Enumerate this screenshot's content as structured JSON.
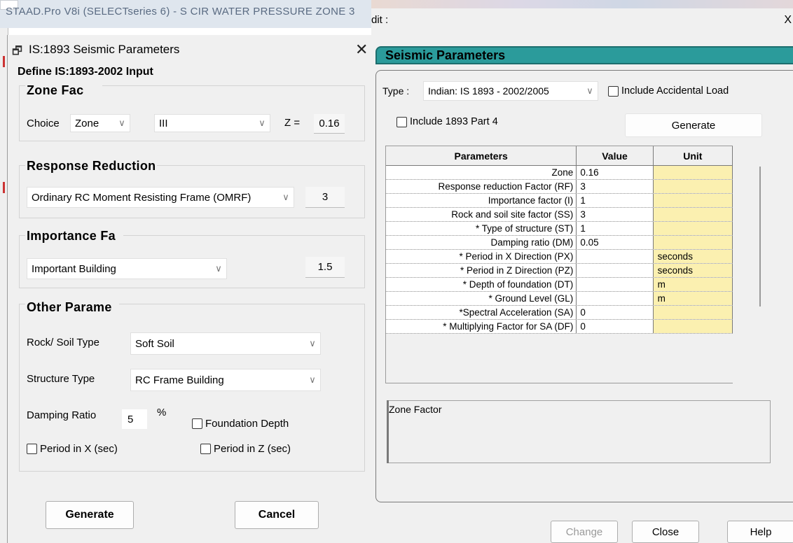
{
  "background_window": {
    "title_text": "STAAD.Pro V8i (SELECTseries 6) - S CIR WATER PRESSURE ZONE 3"
  },
  "left_dialog": {
    "title": "IS:1893 Seismic Parameters",
    "close_glyph": "✕",
    "define_header": "Define IS:1893-2002 Input",
    "zone_group": {
      "title": "Zone Fac",
      "choice_label": "Choice",
      "choice_value": "Zone",
      "zone_value": "III",
      "z_label": "Z =",
      "z_value": "0.16"
    },
    "response_group": {
      "title": "Response Reduction",
      "frame_value": "Ordinary RC Moment Resisting Frame (OMRF)",
      "rf_value": "3"
    },
    "importance_group": {
      "title": "Importance Fa",
      "building_value": "Important Building",
      "factor_value": "1.5"
    },
    "other_group": {
      "title": "Other Parame",
      "rock_soil_label": "Rock/ Soil Type",
      "rock_soil_value": "Soft Soil",
      "structure_label": "Structure Type",
      "structure_value": "RC Frame Building",
      "damping_label": "Damping Ratio",
      "damping_value": "5",
      "damping_unit": "%",
      "foundation_label": "Foundation Depth",
      "period_x_label": "Period in X (sec)",
      "period_z_label": "Period in Z (sec)"
    },
    "generate_label": "Generate",
    "cancel_label": "Cancel"
  },
  "right_dialog": {
    "edit_label": "dit :",
    "close_glyph": "X",
    "tab_title": "Seismic Parameters",
    "type_label": "Type :",
    "type_value": "Indian: IS 1893 - 2002/2005",
    "include_accidental_label": "Include Accidental Load",
    "include_part4_label": "Include 1893 Part 4",
    "generate_label": "Generate",
    "table": {
      "headers": [
        "Parameters",
        "Value",
        "Unit"
      ],
      "rows": [
        {
          "param": "Zone",
          "value": "0.16",
          "unit": ""
        },
        {
          "param": "Response reduction Factor (RF)",
          "value": "3",
          "unit": ""
        },
        {
          "param": "Importance factor (I)",
          "value": "1",
          "unit": ""
        },
        {
          "param": "Rock and soil site factor (SS)",
          "value": "3",
          "unit": ""
        },
        {
          "param": "* Type of structure (ST)",
          "value": "1",
          "unit": ""
        },
        {
          "param": "Damping ratio (DM)",
          "value": "0.05",
          "unit": ""
        },
        {
          "param": "* Period in X Direction (PX)",
          "value": "",
          "unit": "seconds"
        },
        {
          "param": "* Period in Z Direction (PZ)",
          "value": "",
          "unit": "seconds"
        },
        {
          "param": "* Depth of foundation (DT)",
          "value": "",
          "unit": "m"
        },
        {
          "param": "* Ground Level (GL)",
          "value": "",
          "unit": "m"
        },
        {
          "param": "*Spectral Acceleration (SA)",
          "value": "0",
          "unit": ""
        },
        {
          "param": "* Multiplying Factor for SA (DF)",
          "value": "0",
          "unit": ""
        }
      ]
    },
    "description": "Zone Factor",
    "change_label": "Change",
    "close_label": "Close",
    "help_label": "Help"
  }
}
